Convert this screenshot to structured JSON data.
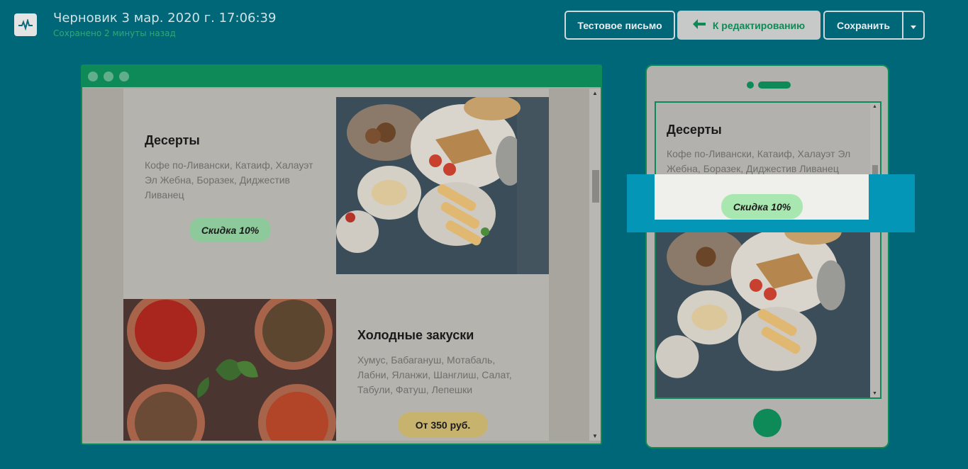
{
  "header": {
    "title": "Черновик 3 мар. 2020 г. 17:06:39",
    "subtitle": "Сохранено 2 минуты назад",
    "test_button": "Тестовое письмо",
    "back_button": "К редактированию",
    "save_button": "Сохранить"
  },
  "email": {
    "desserts": {
      "title": "Десерты",
      "text": "Кофе по-Ливански, Катаиф, Халауэт Эл Жебна, Боразек, Диджестив Ливанец",
      "badge": "Скидка 10%"
    },
    "cold": {
      "title": "Холодные закуски",
      "text": "Хумус, Бабагануш, Мотабаль, Лабни, Яланжи, Шанглиш, Салат, Табули, Фатуш, Лепешки",
      "badge": "От 350 руб."
    }
  },
  "colors": {
    "background": "#006778",
    "accent": "#0d8a57",
    "badge_green": "#8dc99a",
    "badge_gold": "#c8b36e"
  }
}
